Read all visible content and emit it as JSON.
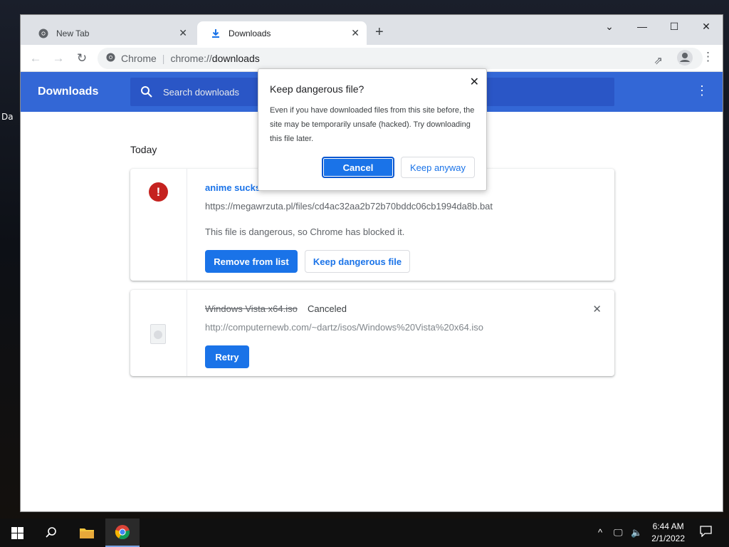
{
  "desktop": {
    "edge_labels": [
      "Da"
    ]
  },
  "browser": {
    "tabs": [
      {
        "label": "New Tab",
        "active": false,
        "icon": "chrome-icon"
      },
      {
        "label": "Downloads",
        "active": true,
        "icon": "download-icon"
      }
    ],
    "address_bar": {
      "site_label": "Chrome",
      "url_scheme": "chrome://",
      "url_path": "downloads"
    }
  },
  "downloads_page": {
    "title": "Downloads",
    "search_placeholder": "Search downloads",
    "section_today": "Today",
    "items": [
      {
        "file_name": "anime sucks.",
        "url": "https://megawrzuta.pl/files/cd4ac32aa2b72b70bddc06cb1994da8b.bat",
        "warning": "This file is dangerous, so Chrome has blocked it.",
        "remove_label": "Remove from list",
        "keep_label": "Keep dangerous file"
      },
      {
        "file_name": "Windows Vista x64.iso",
        "status": "Canceled",
        "url": "http://computernewb.com/~dartz/isos/Windows%20Vista%20x64.iso",
        "retry_label": "Retry"
      }
    ]
  },
  "dialog": {
    "title": "Keep dangerous file?",
    "body": "Even if you have downloaded files from this site before, the site may be temporarily unsafe (hacked). Try downloading this file later.",
    "cancel_label": "Cancel",
    "keep_label": "Keep anyway"
  },
  "taskbar": {
    "time": "6:44 AM",
    "date": "2/1/2022"
  },
  "colors": {
    "accent": "#1a73e8",
    "header": "#3367d6",
    "danger": "#c5221f"
  }
}
